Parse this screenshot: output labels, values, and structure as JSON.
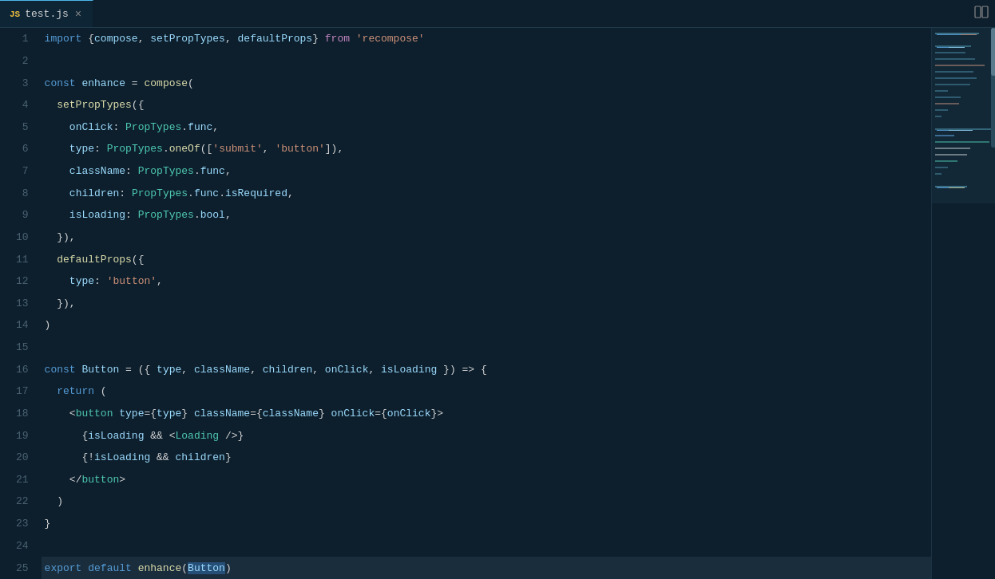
{
  "tab": {
    "icon": "JS",
    "label": "test.js",
    "close_label": "×"
  },
  "editor": {
    "split_icon": "⊟",
    "lines": [
      {
        "num": 1,
        "html": "<span class='kw'>import</span> <span class='punc'>{</span><span class='prop'>compose</span><span class='punc'>,</span> <span class='prop'>setPropTypes</span><span class='punc'>,</span> <span class='prop'>defaultProps</span><span class='punc'>}</span> <span class='kw2'>from</span> <span class='str'>'recompose'</span>"
      },
      {
        "num": 2,
        "html": ""
      },
      {
        "num": 3,
        "html": "<span class='kw'>const</span> <span class='prop'>enhance</span> <span class='punc'>=</span> <span class='func-name'>compose</span><span class='punc'>(</span>"
      },
      {
        "num": 4,
        "html": "  <span class='func-name'>setPropTypes</span><span class='punc'>({</span>"
      },
      {
        "num": 5,
        "html": "    <span class='prop'>onClick</span><span class='punc'>:</span> <span class='type-name'>PropTypes</span><span class='punc'>.</span><span class='prop'>func</span><span class='punc'>,</span>"
      },
      {
        "num": 6,
        "html": "    <span class='prop'>type</span><span class='punc'>:</span> <span class='type-name'>PropTypes</span><span class='punc'>.</span><span class='func-name'>oneOf</span><span class='punc'>([</span><span class='str'>'submit'</span><span class='punc'>,</span> <span class='str'>'button'</span><span class='punc'>]),</span>"
      },
      {
        "num": 7,
        "html": "    <span class='prop'>className</span><span class='punc'>:</span> <span class='type-name'>PropTypes</span><span class='punc'>.</span><span class='prop'>func</span><span class='punc'>,</span>"
      },
      {
        "num": 8,
        "html": "    <span class='prop'>children</span><span class='punc'>:</span> <span class='type-name'>PropTypes</span><span class='punc'>.</span><span class='prop'>func</span><span class='punc'>.</span><span class='prop'>isRequired</span><span class='punc'>,</span>"
      },
      {
        "num": 9,
        "html": "    <span class='prop'>isLoading</span><span class='punc'>:</span> <span class='type-name'>PropTypes</span><span class='punc'>.</span><span class='prop'>bool</span><span class='punc'>,</span>"
      },
      {
        "num": 10,
        "html": "  <span class='punc'>}),</span>"
      },
      {
        "num": 11,
        "html": "  <span class='func-name'>defaultProps</span><span class='punc'>({</span>"
      },
      {
        "num": 12,
        "html": "    <span class='prop'>type</span><span class='punc'>:</span> <span class='str'>'button'</span><span class='punc'>,</span>"
      },
      {
        "num": 13,
        "html": "  <span class='punc'>}),</span>"
      },
      {
        "num": 14,
        "html": "<span class='punc'>)</span>"
      },
      {
        "num": 15,
        "html": ""
      },
      {
        "num": 16,
        "html": "<span class='kw'>const</span> <span class='prop'>Button</span> <span class='punc'>= ({</span> <span class='prop'>type</span><span class='punc'>,</span> <span class='prop'>className</span><span class='punc'>,</span> <span class='prop'>children</span><span class='punc'>,</span> <span class='prop'>onClick</span><span class='punc'>,</span> <span class='prop'>isLoading</span> <span class='punc'>}) =></span> <span class='punc'>{</span>"
      },
      {
        "num": 17,
        "html": "  <span class='kw'>return</span> <span class='punc'>(</span>"
      },
      {
        "num": 18,
        "html": "    <span class='punc'>&lt;</span><span class='jsx-tag'>button</span> <span class='jsx-attr'>type</span><span class='punc'>={</span><span class='prop'>type</span><span class='punc'>}</span> <span class='jsx-attr'>className</span><span class='punc'>={</span><span class='prop'>className</span><span class='punc'>}</span> <span class='jsx-attr'>onClick</span><span class='punc'>={</span><span class='prop'>onClick</span><span class='punc'>}&gt;</span>"
      },
      {
        "num": 19,
        "html": "      <span class='punc'>{</span><span class='prop'>isLoading</span> <span class='punc'>&amp;&amp;</span> <span class='punc'>&lt;</span><span class='jsx-tag'>Loading</span> <span class='punc'>/&gt;}</span>"
      },
      {
        "num": 20,
        "html": "      <span class='punc'>{!</span><span class='prop'>isLoading</span> <span class='punc'>&amp;&amp;</span> <span class='prop'>children</span><span class='punc'>}</span>"
      },
      {
        "num": 21,
        "html": "    <span class='punc'>&lt;/</span><span class='jsx-tag'>button</span><span class='punc'>&gt;</span>"
      },
      {
        "num": 22,
        "html": "  <span class='punc'>)</span>"
      },
      {
        "num": 23,
        "html": "<span class='punc'>}</span>"
      },
      {
        "num": 24,
        "html": ""
      },
      {
        "num": 25,
        "html": "<span class='kw'>export</span> <span class='kw'>default</span> <span class='func-name'>enhance</span><span class='punc'>(</span><span class='selected'><span class='prop'>Button</span></span><span class='punc'>)</span>"
      }
    ]
  }
}
